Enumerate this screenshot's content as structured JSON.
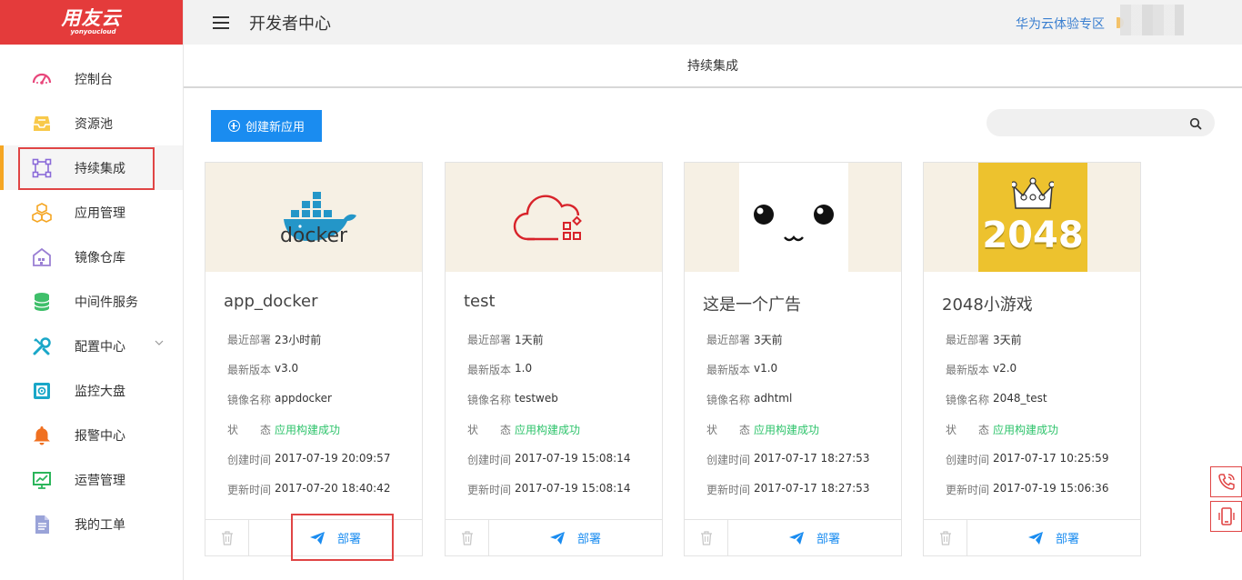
{
  "logo": {
    "cn": "用友云",
    "en": "yonyoucloud"
  },
  "header": {
    "title": "开发者中心",
    "link": "华为云体验专区"
  },
  "sidebar": {
    "items": [
      {
        "label": "控制台",
        "icon": "dashboard-icon"
      },
      {
        "label": "资源池",
        "icon": "inbox-icon"
      },
      {
        "label": "持续集成",
        "icon": "integration-icon"
      },
      {
        "label": "应用管理",
        "icon": "cubes-icon"
      },
      {
        "label": "镜像仓库",
        "icon": "warehouse-icon"
      },
      {
        "label": "中间件服务",
        "icon": "database-icon"
      },
      {
        "label": "配置中心",
        "icon": "tools-icon"
      },
      {
        "label": "监控大盘",
        "icon": "monitor-icon"
      },
      {
        "label": "报警中心",
        "icon": "bell-icon"
      },
      {
        "label": "运营管理",
        "icon": "chart-screen-icon"
      },
      {
        "label": "我的工单",
        "icon": "document-icon"
      }
    ],
    "active": "持续集成"
  },
  "subheader": {
    "title": "持续集成"
  },
  "toolbar": {
    "create_label": "创建新应用",
    "search_placeholder": ""
  },
  "field_labels": {
    "last_deploy": "最近部署",
    "version": "最新版本",
    "image": "镜像名称",
    "status": "状　　态",
    "created": "创建时间",
    "updated": "更新时间"
  },
  "deploy_label": "部署",
  "cards": [
    {
      "name": "app_docker",
      "last_deploy": "23小时前",
      "version": "v3.0",
      "image": "appdocker",
      "status": "应用构建成功",
      "created": "2017-07-19 20:09:57",
      "updated": "2017-07-20 18:40:42",
      "thumb_text": "docker"
    },
    {
      "name": "test",
      "last_deploy": "1天前",
      "version": "1.0",
      "image": "testweb",
      "status": "应用构建成功",
      "created": "2017-07-19 15:08:14",
      "updated": "2017-07-19 15:08:14"
    },
    {
      "name": "这是一个广告",
      "last_deploy": "3天前",
      "version": "v1.0",
      "image": "adhtml",
      "status": "应用构建成功",
      "created": "2017-07-17 18:27:53",
      "updated": "2017-07-17 18:27:53"
    },
    {
      "name": "2048小游戏",
      "last_deploy": "3天前",
      "version": "v2.0",
      "image": "2048_test",
      "status": "应用构建成功",
      "created": "2017-07-17 10:25:59",
      "updated": "2017-07-19 15:06:36",
      "thumb_text": "2048"
    }
  ],
  "colors": {
    "brand": "#e43b3b",
    "primary": "#1a8cf0",
    "success": "#2ec36b",
    "active_bar": "#f5a623"
  }
}
